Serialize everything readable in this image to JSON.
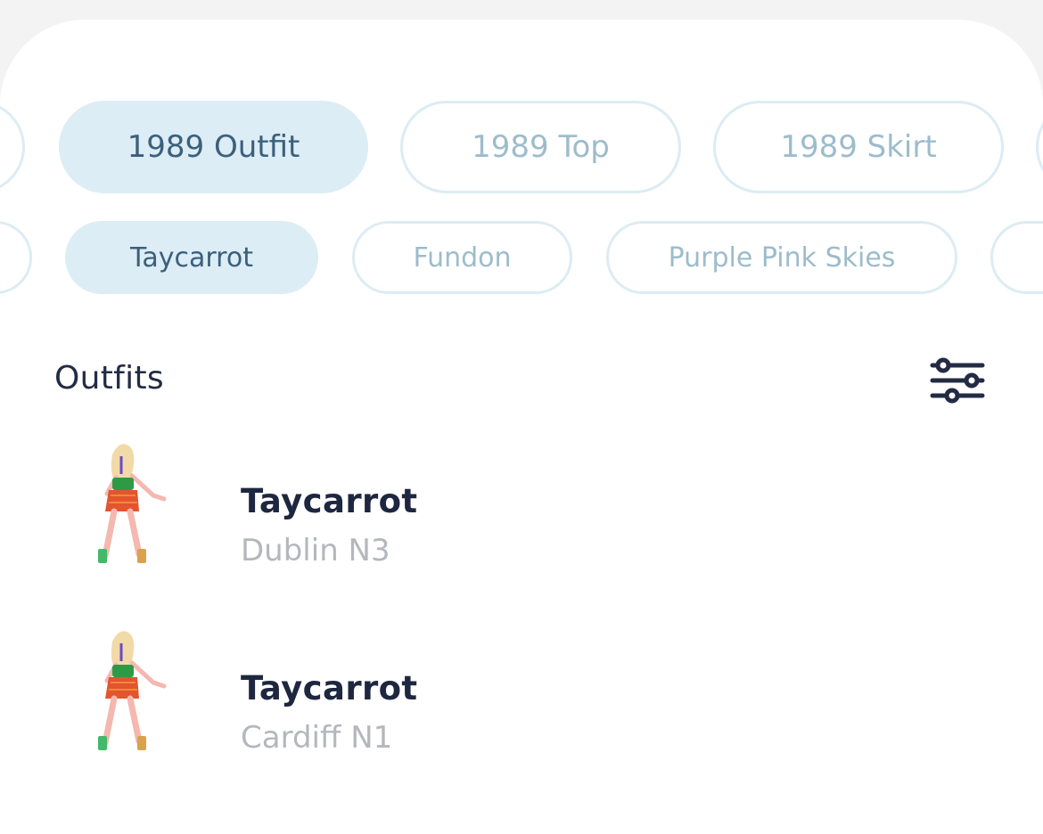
{
  "categories": {
    "items": [
      {
        "label": "",
        "active": false
      },
      {
        "label": "1989 Outfit",
        "active": true
      },
      {
        "label": "1989 Top",
        "active": false
      },
      {
        "label": "1989 Skirt",
        "active": false
      },
      {
        "label": "",
        "active": false
      }
    ]
  },
  "styles": {
    "items": [
      {
        "label": "",
        "active": false
      },
      {
        "label": "Taycarrot",
        "active": true
      },
      {
        "label": "Fundon",
        "active": false
      },
      {
        "label": "Purple Pink Skies",
        "active": false
      },
      {
        "label": "",
        "active": false
      }
    ]
  },
  "section": {
    "title": "Outfits",
    "filter_icon": "sliders-icon"
  },
  "outfits": [
    {
      "title": "Taycarrot",
      "subtitle": "Dublin N3",
      "thumbnail_icon": "outfit-figure-icon"
    },
    {
      "title": "Taycarrot",
      "subtitle": "Cardiff N1",
      "thumbnail_icon": "outfit-figure-icon"
    }
  ],
  "colors": {
    "chip_active_bg": "#dcedf5",
    "chip_active_text": "#3c5f7c",
    "chip_inactive_text": "#9dbccb",
    "chip_border": "#dcecf3",
    "title_text": "#1e2740",
    "subtitle_text": "#b4b7bc"
  }
}
